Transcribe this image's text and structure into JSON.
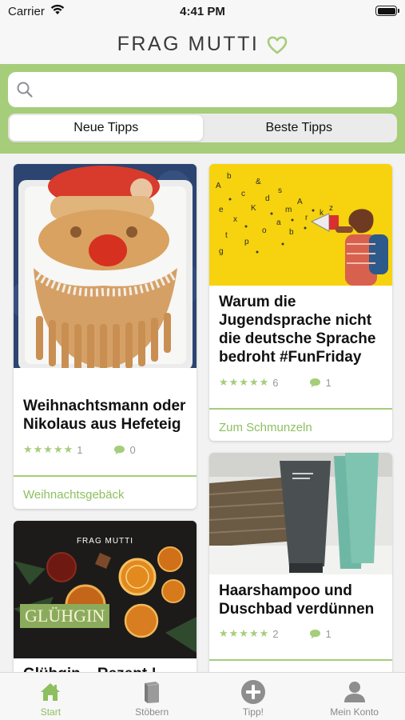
{
  "status_bar": {
    "carrier": "Carrier",
    "time": "4:41 PM"
  },
  "header": {
    "logo_text": "FRAG MUTTI"
  },
  "search": {
    "placeholder": "",
    "value": ""
  },
  "segments": [
    {
      "label": "Neue Tipps",
      "selected": true
    },
    {
      "label": "Beste Tipps",
      "selected": false
    }
  ],
  "cards": [
    {
      "title": "Weihnachtsmann oder Nikolaus aus Hefeteig",
      "rating": 5,
      "rating_count": "1",
      "comments": "0",
      "category": "Weihnachtsgebäck"
    },
    {
      "title": "Warum die Jugendsprache nicht die deutsche Sprache bedroht #FunFriday",
      "rating": 5,
      "rating_count": "6",
      "comments": "1",
      "category": "Zum Schmunzeln"
    },
    {
      "title": "Glühgin – Rezept !",
      "image_overlay": "GLÜHGIN",
      "image_brand": "FRAG MUTTI",
      "partial": true
    },
    {
      "title": "Haarshampoo und Duschbad verdünnen",
      "rating": 5,
      "rating_count": "2",
      "comments": "1"
    }
  ],
  "tabbar": [
    {
      "label": "Start",
      "icon": "home-icon",
      "active": true
    },
    {
      "label": "Stöbern",
      "icon": "book-icon",
      "active": false
    },
    {
      "label": "Tipp!",
      "icon": "plus-circle-icon",
      "active": false
    },
    {
      "label": "Mein Konto",
      "icon": "person-icon",
      "active": false
    }
  ],
  "colors": {
    "accent": "#a6cd7a",
    "accent_text": "#8dbf5f",
    "background": "#f2f2f2"
  }
}
